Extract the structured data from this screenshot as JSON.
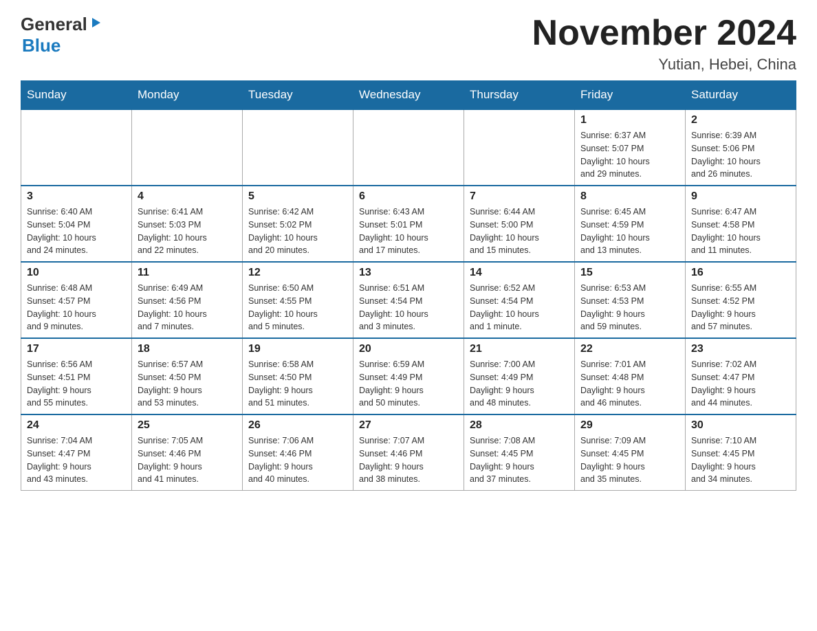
{
  "header": {
    "logo_general": "General",
    "logo_blue": "Blue",
    "month_title": "November 2024",
    "location": "Yutian, Hebei, China"
  },
  "weekdays": [
    "Sunday",
    "Monday",
    "Tuesday",
    "Wednesday",
    "Thursday",
    "Friday",
    "Saturday"
  ],
  "weeks": [
    [
      {
        "day": "",
        "info": ""
      },
      {
        "day": "",
        "info": ""
      },
      {
        "day": "",
        "info": ""
      },
      {
        "day": "",
        "info": ""
      },
      {
        "day": "",
        "info": ""
      },
      {
        "day": "1",
        "info": "Sunrise: 6:37 AM\nSunset: 5:07 PM\nDaylight: 10 hours\nand 29 minutes."
      },
      {
        "day": "2",
        "info": "Sunrise: 6:39 AM\nSunset: 5:06 PM\nDaylight: 10 hours\nand 26 minutes."
      }
    ],
    [
      {
        "day": "3",
        "info": "Sunrise: 6:40 AM\nSunset: 5:04 PM\nDaylight: 10 hours\nand 24 minutes."
      },
      {
        "day": "4",
        "info": "Sunrise: 6:41 AM\nSunset: 5:03 PM\nDaylight: 10 hours\nand 22 minutes."
      },
      {
        "day": "5",
        "info": "Sunrise: 6:42 AM\nSunset: 5:02 PM\nDaylight: 10 hours\nand 20 minutes."
      },
      {
        "day": "6",
        "info": "Sunrise: 6:43 AM\nSunset: 5:01 PM\nDaylight: 10 hours\nand 17 minutes."
      },
      {
        "day": "7",
        "info": "Sunrise: 6:44 AM\nSunset: 5:00 PM\nDaylight: 10 hours\nand 15 minutes."
      },
      {
        "day": "8",
        "info": "Sunrise: 6:45 AM\nSunset: 4:59 PM\nDaylight: 10 hours\nand 13 minutes."
      },
      {
        "day": "9",
        "info": "Sunrise: 6:47 AM\nSunset: 4:58 PM\nDaylight: 10 hours\nand 11 minutes."
      }
    ],
    [
      {
        "day": "10",
        "info": "Sunrise: 6:48 AM\nSunset: 4:57 PM\nDaylight: 10 hours\nand 9 minutes."
      },
      {
        "day": "11",
        "info": "Sunrise: 6:49 AM\nSunset: 4:56 PM\nDaylight: 10 hours\nand 7 minutes."
      },
      {
        "day": "12",
        "info": "Sunrise: 6:50 AM\nSunset: 4:55 PM\nDaylight: 10 hours\nand 5 minutes."
      },
      {
        "day": "13",
        "info": "Sunrise: 6:51 AM\nSunset: 4:54 PM\nDaylight: 10 hours\nand 3 minutes."
      },
      {
        "day": "14",
        "info": "Sunrise: 6:52 AM\nSunset: 4:54 PM\nDaylight: 10 hours\nand 1 minute."
      },
      {
        "day": "15",
        "info": "Sunrise: 6:53 AM\nSunset: 4:53 PM\nDaylight: 9 hours\nand 59 minutes."
      },
      {
        "day": "16",
        "info": "Sunrise: 6:55 AM\nSunset: 4:52 PM\nDaylight: 9 hours\nand 57 minutes."
      }
    ],
    [
      {
        "day": "17",
        "info": "Sunrise: 6:56 AM\nSunset: 4:51 PM\nDaylight: 9 hours\nand 55 minutes."
      },
      {
        "day": "18",
        "info": "Sunrise: 6:57 AM\nSunset: 4:50 PM\nDaylight: 9 hours\nand 53 minutes."
      },
      {
        "day": "19",
        "info": "Sunrise: 6:58 AM\nSunset: 4:50 PM\nDaylight: 9 hours\nand 51 minutes."
      },
      {
        "day": "20",
        "info": "Sunrise: 6:59 AM\nSunset: 4:49 PM\nDaylight: 9 hours\nand 50 minutes."
      },
      {
        "day": "21",
        "info": "Sunrise: 7:00 AM\nSunset: 4:49 PM\nDaylight: 9 hours\nand 48 minutes."
      },
      {
        "day": "22",
        "info": "Sunrise: 7:01 AM\nSunset: 4:48 PM\nDaylight: 9 hours\nand 46 minutes."
      },
      {
        "day": "23",
        "info": "Sunrise: 7:02 AM\nSunset: 4:47 PM\nDaylight: 9 hours\nand 44 minutes."
      }
    ],
    [
      {
        "day": "24",
        "info": "Sunrise: 7:04 AM\nSunset: 4:47 PM\nDaylight: 9 hours\nand 43 minutes."
      },
      {
        "day": "25",
        "info": "Sunrise: 7:05 AM\nSunset: 4:46 PM\nDaylight: 9 hours\nand 41 minutes."
      },
      {
        "day": "26",
        "info": "Sunrise: 7:06 AM\nSunset: 4:46 PM\nDaylight: 9 hours\nand 40 minutes."
      },
      {
        "day": "27",
        "info": "Sunrise: 7:07 AM\nSunset: 4:46 PM\nDaylight: 9 hours\nand 38 minutes."
      },
      {
        "day": "28",
        "info": "Sunrise: 7:08 AM\nSunset: 4:45 PM\nDaylight: 9 hours\nand 37 minutes."
      },
      {
        "day": "29",
        "info": "Sunrise: 7:09 AM\nSunset: 4:45 PM\nDaylight: 9 hours\nand 35 minutes."
      },
      {
        "day": "30",
        "info": "Sunrise: 7:10 AM\nSunset: 4:45 PM\nDaylight: 9 hours\nand 34 minutes."
      }
    ]
  ]
}
